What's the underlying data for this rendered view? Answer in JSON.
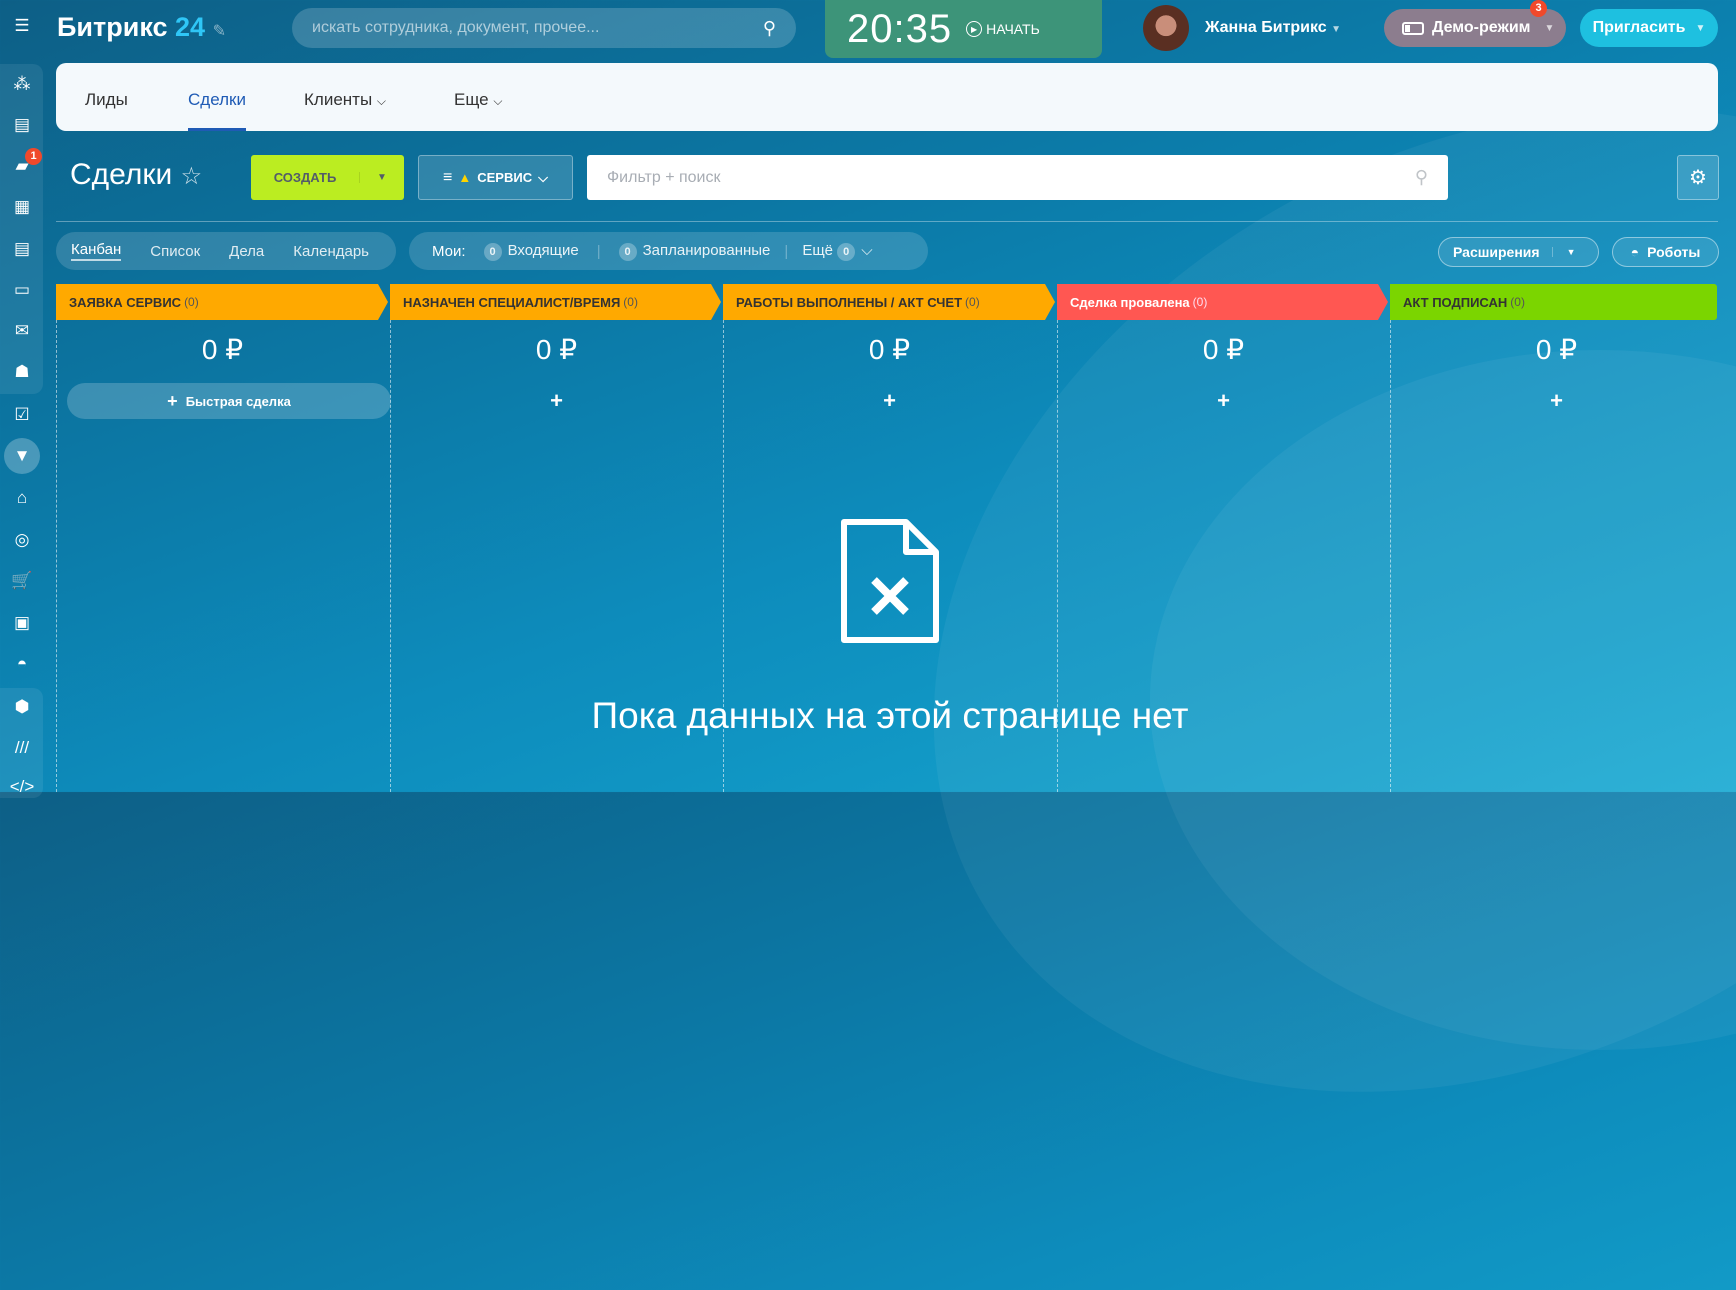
{
  "header": {
    "logo_text": "Битрикс",
    "logo_num": "24",
    "search_placeholder": "искать сотрудника, документ, прочее...",
    "clock": "20:35",
    "start_label": "НАЧАТЬ",
    "user_name": "Жанна Битрикс",
    "demo_label": "Демо-режим",
    "demo_badge": "3",
    "invite_label": "Пригласить"
  },
  "sidebar": {
    "chat_badge": "1"
  },
  "nav": {
    "tabs": [
      {
        "label": "Лиды"
      },
      {
        "label": "Сделки"
      },
      {
        "label": "Клиенты"
      },
      {
        "label": "Еще"
      }
    ],
    "active": "Сделки"
  },
  "toolbar": {
    "title": "Сделки",
    "create_label": "СОЗДАТЬ",
    "category_label": "СЕРВИС",
    "filter_placeholder": "Фильтр + поиск"
  },
  "views": {
    "items": [
      {
        "label": "Канбан"
      },
      {
        "label": "Список"
      },
      {
        "label": "Дела"
      },
      {
        "label": "Календарь"
      }
    ],
    "active": "Канбан"
  },
  "counters": {
    "label": "Мои:",
    "incoming_count": "0",
    "incoming_label": "Входящие",
    "planned_count": "0",
    "planned_label": "Запланированные",
    "more_label": "Ещё",
    "more_count": "0"
  },
  "right_buttons": {
    "extensions": "Расширения",
    "robots": "Роботы"
  },
  "stages": [
    {
      "name": "ЗАЯВКА СЕРВИС",
      "count": "(0)",
      "sum": "0 ₽",
      "color": "#ffa900"
    },
    {
      "name": "НАЗНАЧЕН СПЕЦИАЛИСТ/ВРЕМЯ",
      "count": "(0)",
      "sum": "0 ₽",
      "color": "#ffa900"
    },
    {
      "name": "РАБОТЫ ВЫПОЛНЕНЫ / АКТ СЧЕТ",
      "count": "(0)",
      "sum": "0 ₽",
      "color": "#ffa900"
    },
    {
      "name": "Сделка провалена",
      "count": "(0)",
      "sum": "0 ₽",
      "color": "#ff5752"
    },
    {
      "name": "АКТ ПОДПИСАН",
      "count": "(0)",
      "sum": "0 ₽",
      "color": "#7bd500"
    }
  ],
  "quick_deal": "Быстрая сделка",
  "add_symbol": "+",
  "empty_text": "Пока данных на этой странице нет"
}
